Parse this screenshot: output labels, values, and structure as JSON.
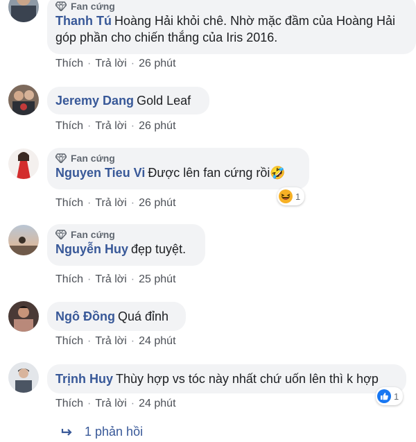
{
  "comments": [
    {
      "badge": "Fan cứng",
      "author": "Thanh Tú",
      "text": "Hoàng Hải khỏi chê. Nhờ mặc đầm của Hoàng Hải góp phần cho chiến thắng của Iris 2016.",
      "like": "Thích",
      "reply": "Trả lời",
      "time": "26 phút"
    },
    {
      "author": "Jeremy Dang",
      "text": "Gold Leaf",
      "like": "Thích",
      "reply": "Trả lời",
      "time": "26 phút"
    },
    {
      "badge": "Fan cứng",
      "author": "Nguyen Tieu Vi",
      "text": "Được lên fan cứng rồi🤣",
      "like": "Thích",
      "reply": "Trả lời",
      "time": "26 phút",
      "reaction": {
        "icon": "haha-emoji-icon",
        "count": "1"
      }
    },
    {
      "badge": "Fan cứng",
      "author": "Nguyễn Huy",
      "text": "đẹp tuyệt.",
      "like": "Thích",
      "reply": "Trả lời",
      "time": "25 phút"
    },
    {
      "author": "Ngô Đồng",
      "text": "Quá đỉnh",
      "like": "Thích",
      "reply": "Trả lời",
      "time": "24 phút"
    },
    {
      "author": "Trịnh Huy",
      "text": "Thùy hợp vs tóc này nhất chứ uốn lên thì k hợp",
      "like": "Thích",
      "reply": "Trả lời",
      "time": "24 phút",
      "reaction": {
        "icon": "like-thumb-icon",
        "count": "1"
      }
    }
  ],
  "replies_link": {
    "icon": "reply-arrow-icon",
    "label": "1 phản hồi"
  },
  "colors": {
    "author": "#385898",
    "bubble": "#f2f3f5",
    "meta": "#90949c",
    "like_blue": "#1877f2",
    "haha_yellow": "#f7b125"
  }
}
